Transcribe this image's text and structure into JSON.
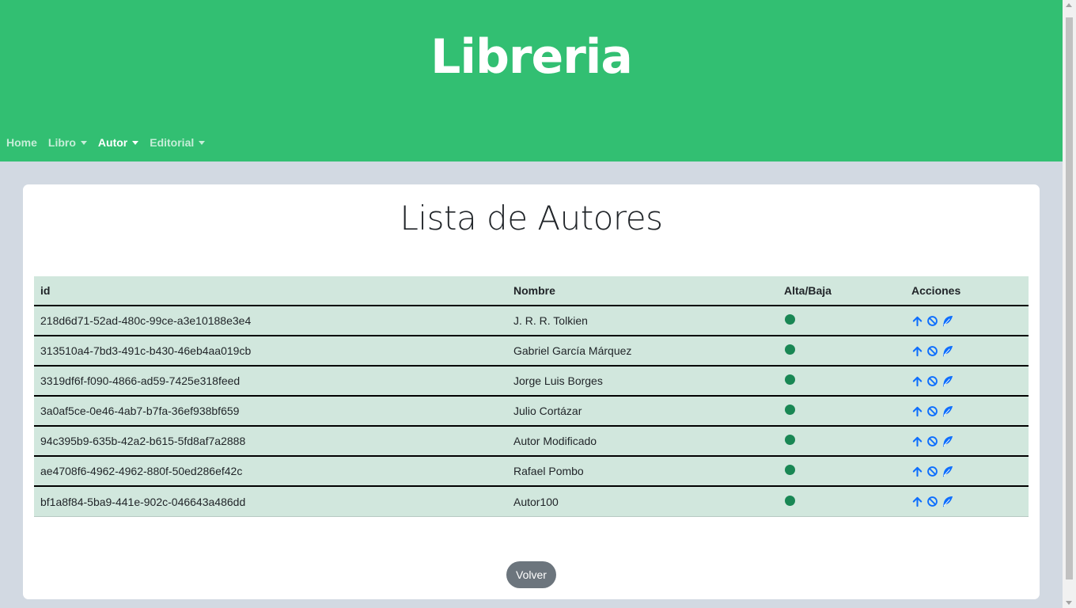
{
  "header": {
    "title": "Libreria",
    "background": "#32bf72"
  },
  "nav": {
    "items": [
      {
        "label": "Home",
        "dropdown": false,
        "active": false
      },
      {
        "label": "Libro",
        "dropdown": true,
        "active": false
      },
      {
        "label": "Autor",
        "dropdown": true,
        "active": true
      },
      {
        "label": "Editorial",
        "dropdown": true,
        "active": false
      }
    ]
  },
  "main": {
    "title": "Lista de Autores",
    "table": {
      "columns": [
        "id",
        "Nombre",
        "Alta/Baja",
        "Acciones"
      ],
      "rows": [
        {
          "id": "218d6d71-52ad-480c-99ce-a3e10188e3e4",
          "nombre": "J. R. R. Tolkien",
          "alta": "active-dot"
        },
        {
          "id": "313510a4-7bd3-491c-b430-46eb4aa019cb",
          "nombre": "Gabriel García Márquez",
          "alta": "active-dot"
        },
        {
          "id": "3319df6f-f090-4866-ad59-7425e318feed",
          "nombre": "Jorge Luis Borges",
          "alta": "active-dot"
        },
        {
          "id": "3a0af5ce-0e46-4ab7-b7fa-36ef938bf659",
          "nombre": "Julio Cortázar",
          "alta": "active-dot"
        },
        {
          "id": "94c395b9-635b-42a2-b615-5fd8af7a2888",
          "nombre": "Autor Modificado",
          "alta": "active-dot"
        },
        {
          "id": "ae4708f6-4962-4962-880f-50ed286ef42c",
          "nombre": "Rafael Pombo",
          "alta": "active-dot"
        },
        {
          "id": "bf1a8f84-5ba9-441e-902c-046643a486dd",
          "nombre": "Autor100",
          "alta": "active-dot"
        }
      ],
      "row_actions": [
        "arrow-up-icon",
        "ban-icon",
        "feather-icon"
      ]
    },
    "volver_label": "Volver"
  },
  "colors": {
    "accent": "#32bf72",
    "table_bg": "#d1e7dd",
    "status_active": "#198754",
    "action_icon": "#0d6efd",
    "button": "#6c757d"
  }
}
